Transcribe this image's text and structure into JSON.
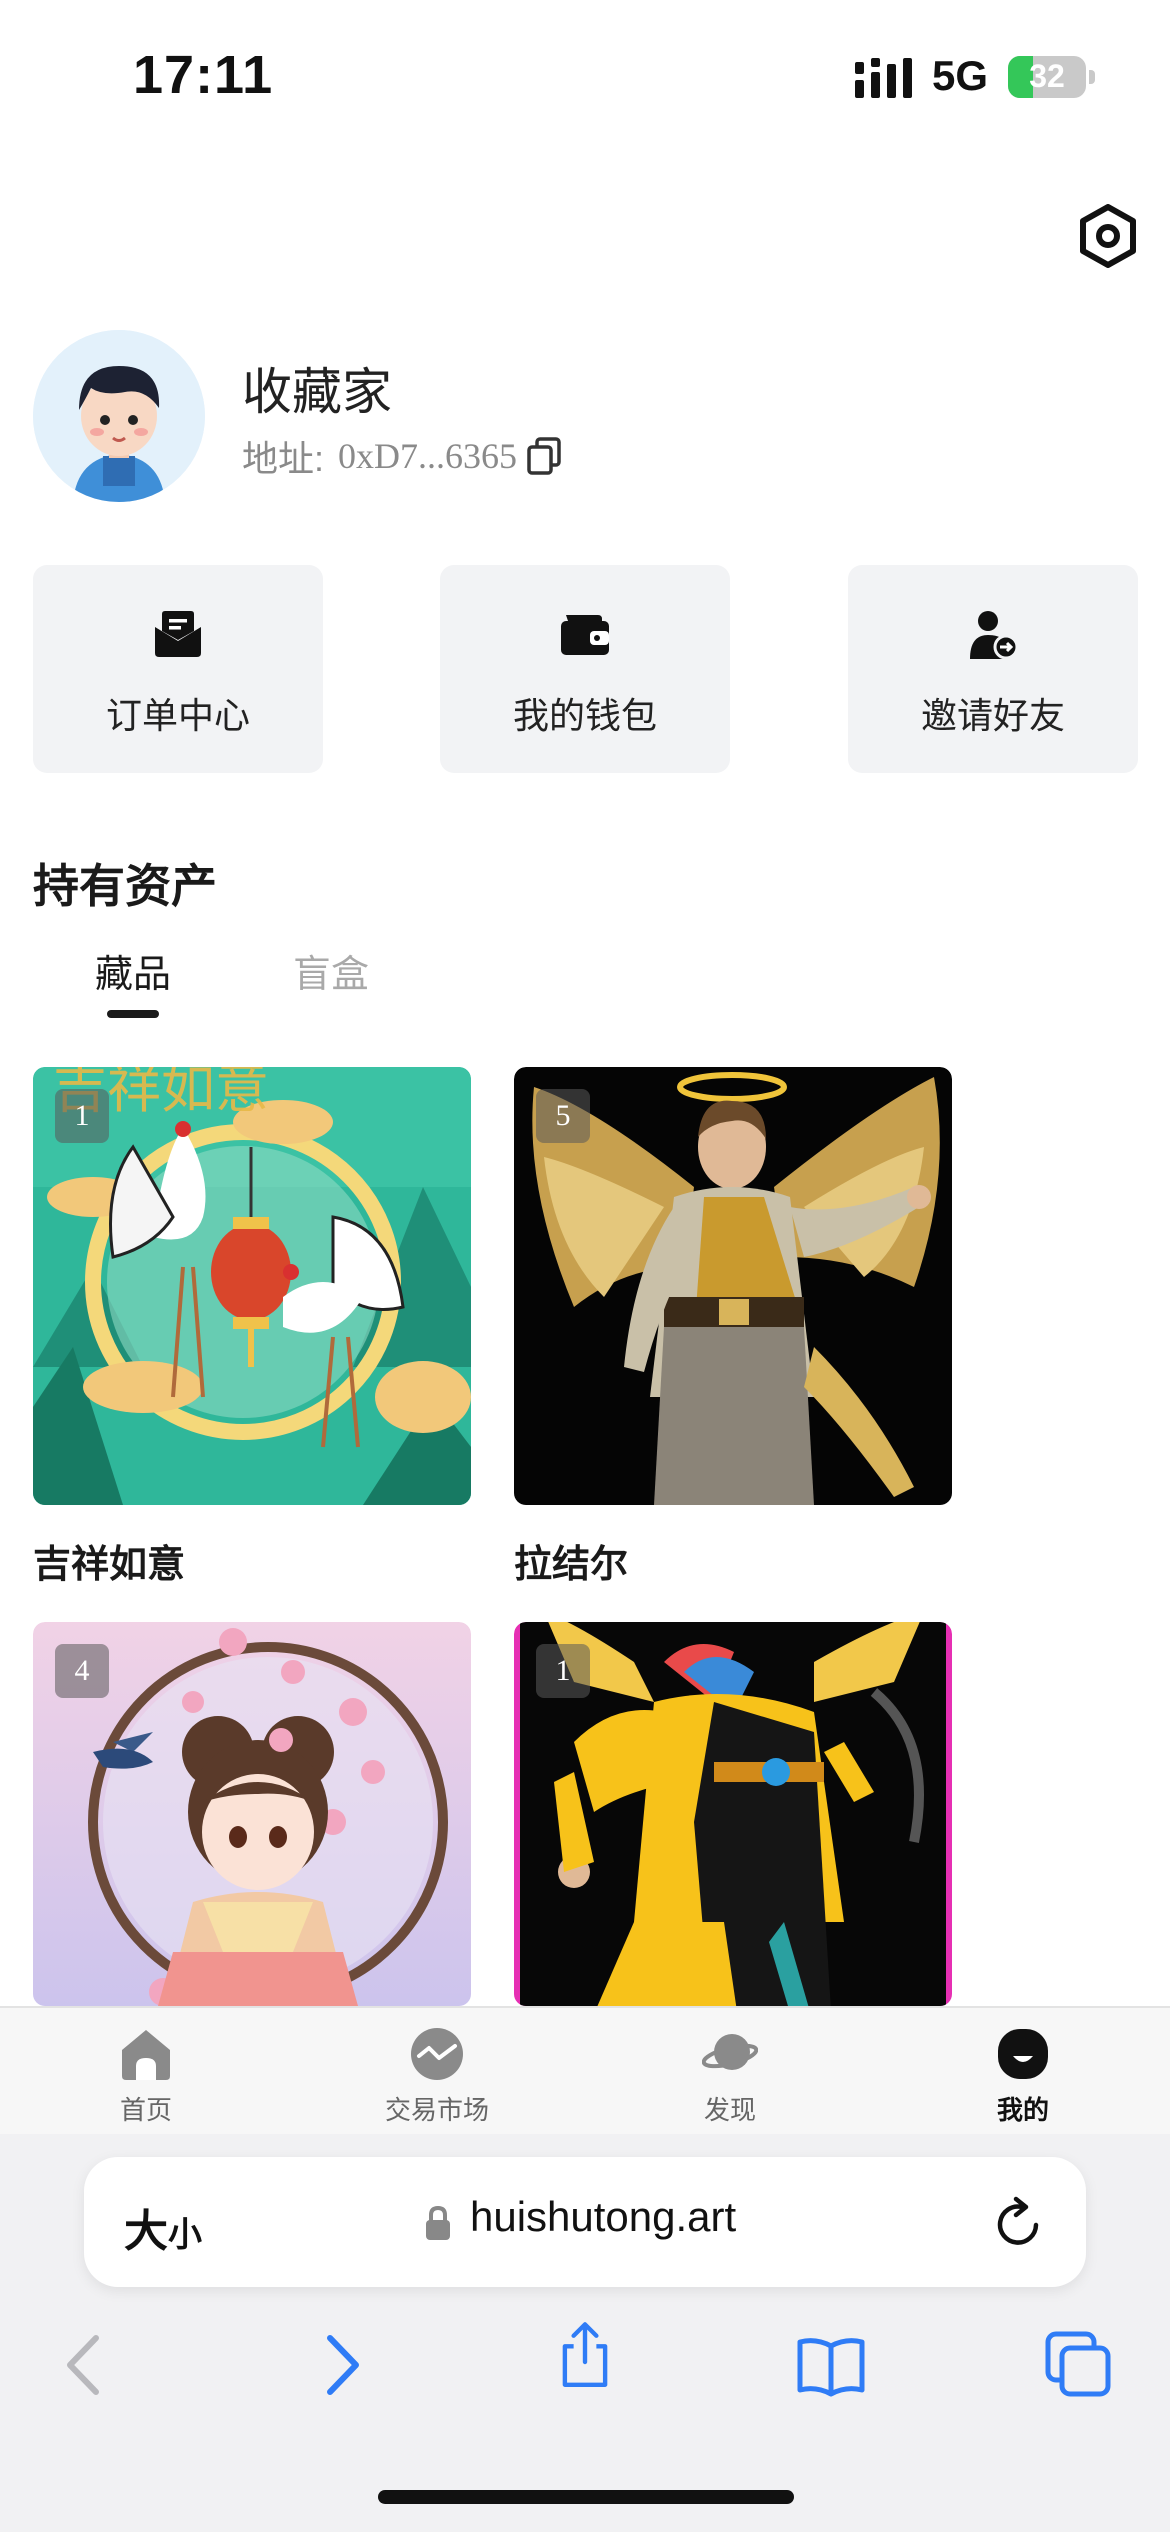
{
  "status_bar": {
    "time": "17:11",
    "network": "5G",
    "battery": "32",
    "battery_level_pct": 32
  },
  "profile": {
    "name": "收藏家",
    "address_label": "地址:",
    "address": "0xD7...6365"
  },
  "quick_actions": [
    {
      "label": "订单中心",
      "icon": "mail-icon"
    },
    {
      "label": "我的钱包",
      "icon": "wallet-icon"
    },
    {
      "label": "邀请好友",
      "icon": "invite-user-icon"
    }
  ],
  "assets": {
    "title": "持有资产",
    "tabs": [
      {
        "label": "藏品",
        "active": true
      },
      {
        "label": "盲盒",
        "active": false
      }
    ],
    "items": [
      {
        "title": "吉祥如意",
        "count": "1"
      },
      {
        "title": "拉结尔",
        "count": "5"
      },
      {
        "title": "",
        "count": "4"
      },
      {
        "title": "",
        "count": "1"
      }
    ]
  },
  "tabbar": [
    {
      "label": "首页",
      "icon": "home-icon",
      "active": false
    },
    {
      "label": "交易市场",
      "icon": "market-icon",
      "active": false
    },
    {
      "label": "发现",
      "icon": "planet-icon",
      "active": false
    },
    {
      "label": "我的",
      "icon": "profile-icon",
      "active": true
    }
  ],
  "browser": {
    "text_size_label": "大",
    "text_size_small": "小",
    "url": "huishutong.art"
  },
  "colors": {
    "accent": "#111111",
    "card_bg": "#f2f3f5",
    "browser_blue": "#2f7cf6",
    "battery_green": "#34c759"
  }
}
